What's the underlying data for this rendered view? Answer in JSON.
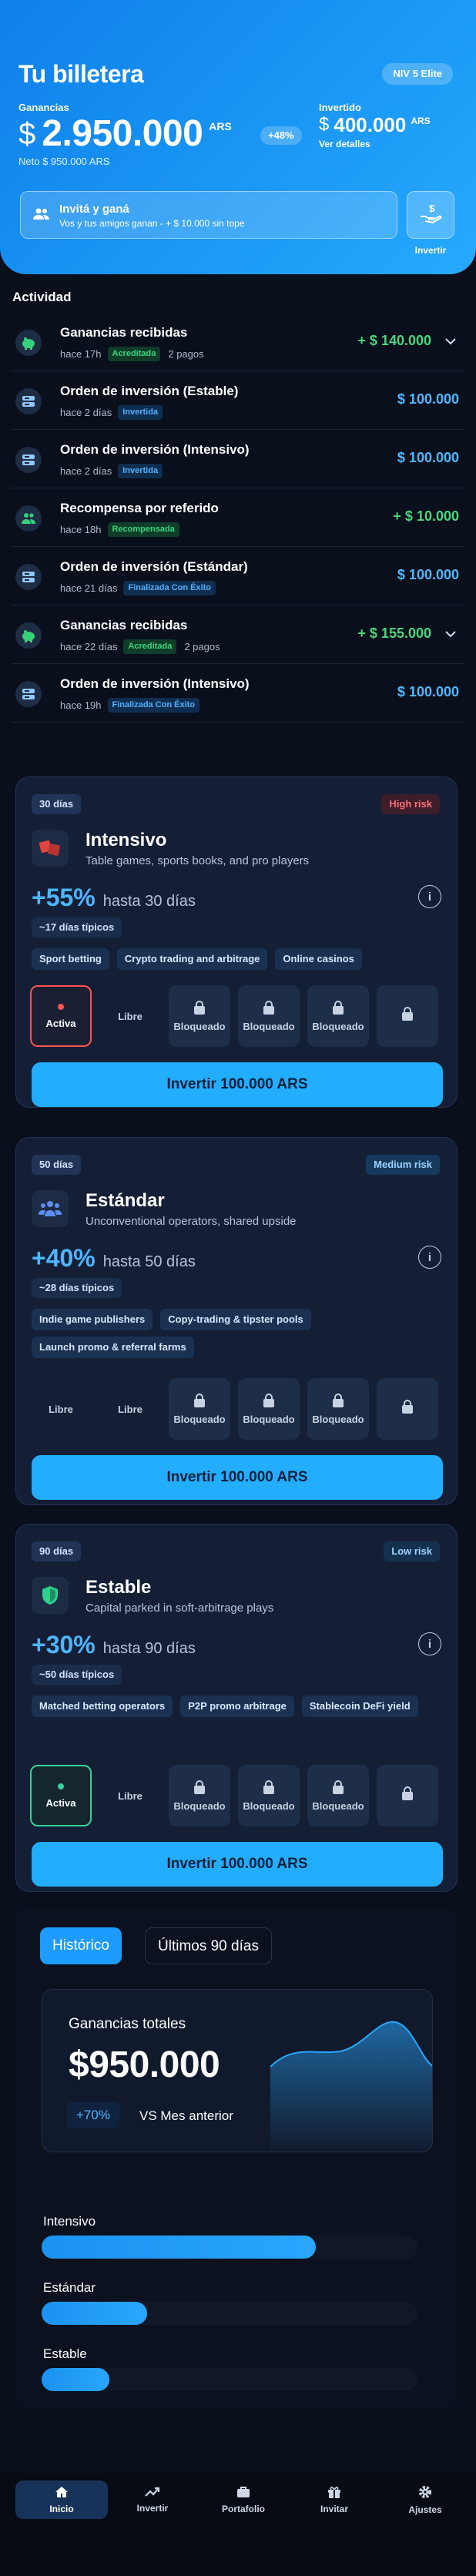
{
  "header": {
    "title": "Tu billetera",
    "level": "NIV 5 Elite",
    "balance_label": "Ganancias",
    "currency_symbol": "$",
    "balance": "2.950.000",
    "balance_unit": "ARS",
    "balance_change": "+48%",
    "net": "Neto $ 950.000 ARS",
    "invested_label": "Invertido",
    "invested": "400.000",
    "invested_unit": "ARS",
    "details": "Ver detalles",
    "invite_title": "Invitá y ganá",
    "invite_sub": "Vos y tus amigos ganan - + $ 10.000 sin tope",
    "invest_button": "Invertir"
  },
  "activity": {
    "title": "Actividad",
    "rows": [
      {
        "title": "Ganancias recibidas",
        "time": "hace 17h",
        "badge": "Acreditada",
        "badge_type": "green",
        "payments": "2 pagos",
        "amount": "+ $ 140.000",
        "positive": true,
        "expand": true,
        "icon": "piggy-bank-icon"
      },
      {
        "title": "Orden de inversión (Estable)",
        "time": "hace 2 días",
        "badge": "Invertida",
        "badge_type": "blue",
        "payments": "",
        "amount": "$ 100.000",
        "positive": false,
        "expand": false,
        "icon": "order-icon"
      },
      {
        "title": "Orden de inversión (Intensivo)",
        "time": "hace 2 días",
        "badge": "Invertida",
        "badge_type": "blue",
        "payments": "",
        "amount": "$ 100.000",
        "positive": false,
        "expand": false,
        "icon": "order-icon"
      },
      {
        "title": "Recompensa por referido",
        "time": "hace 18h",
        "badge": "Recompensada",
        "badge_type": "green",
        "payments": "",
        "amount": "+ $ 10.000",
        "positive": true,
        "expand": false,
        "icon": "users-icon"
      },
      {
        "title": "Orden de inversión (Estándar)",
        "time": "hace 21 días",
        "badge": "Finalizada Con Éxito",
        "badge_type": "blue",
        "payments": "",
        "amount": "$ 100.000",
        "positive": false,
        "expand": false,
        "icon": "order-icon"
      },
      {
        "title": "Ganancias recibidas",
        "time": "hace 22 días",
        "badge": "Acreditada",
        "badge_type": "green",
        "payments": "2 pagos",
        "amount": "+ $ 155.000",
        "positive": true,
        "expand": true,
        "icon": "piggy-bank-icon"
      },
      {
        "title": "Orden de inversión (Intensivo)",
        "time": "hace 19h",
        "badge": "Finalizada Con Éxito",
        "badge_type": "blue",
        "payments": "",
        "amount": "$ 100.000",
        "positive": false,
        "expand": false,
        "icon": "order-icon"
      }
    ]
  },
  "plans": [
    {
      "days": "30 días",
      "risk": "High risk",
      "risk_type": "high",
      "name": "Intensivo",
      "desc": "Table games, sports books, and pro players",
      "yield": "+55%",
      "horizon": "hasta 30 días",
      "typical": "~17 días típicos",
      "tags": [
        "Sport betting",
        "Crypto trading and arbitrage",
        "Online casinos"
      ],
      "slots": [
        {
          "label": "Activa",
          "state": "active-red"
        },
        {
          "label": "Libre",
          "state": "free"
        },
        {
          "label": "Bloqueado",
          "state": "locked"
        },
        {
          "label": "Bloqueado",
          "state": "locked"
        },
        {
          "label": "Bloqueado",
          "state": "locked"
        },
        {
          "label": "",
          "state": "locked"
        }
      ],
      "cta": "Invertir 100.000 ARS",
      "icon": "dice-icon",
      "accent": "#e0443f"
    },
    {
      "days": "50 días",
      "risk": "Medium risk",
      "risk_type": "med",
      "name": "Estándar",
      "desc": "Unconventional operators, shared upside",
      "yield": "+40%",
      "horizon": "hasta 50 días",
      "typical": "~28 días típicos",
      "tags": [
        "Indie game publishers",
        "Copy-trading & tipster pools",
        "Launch promo & referral farms"
      ],
      "slots": [
        {
          "label": "Libre",
          "state": "free"
        },
        {
          "label": "Libre",
          "state": "free"
        },
        {
          "label": "Bloqueado",
          "state": "locked"
        },
        {
          "label": "Bloqueado",
          "state": "locked"
        },
        {
          "label": "Bloqueado",
          "state": "locked"
        },
        {
          "label": "",
          "state": "locked"
        }
      ],
      "cta": "Invertir 100.000 ARS",
      "icon": "group-icon",
      "accent": "#5b8ef0"
    },
    {
      "days": "90 días",
      "risk": "Low risk",
      "risk_type": "low",
      "name": "Estable",
      "desc": "Capital parked in soft-arbitrage plays",
      "yield": "+30%",
      "horizon": "hasta 90 días",
      "typical": "~50 días típicos",
      "tags": [
        "Matched betting operators",
        "P2P promo arbitrage",
        "Stablecoin DeFi yield"
      ],
      "slots": [
        {
          "label": "Activa",
          "state": "active-green"
        },
        {
          "label": "Libre",
          "state": "free"
        },
        {
          "label": "Bloqueado",
          "state": "locked"
        },
        {
          "label": "Bloqueado",
          "state": "locked"
        },
        {
          "label": "Bloqueado",
          "state": "locked"
        },
        {
          "label": "",
          "state": "locked"
        }
      ],
      "cta": "Invertir 100.000 ARS",
      "icon": "shield-icon",
      "accent": "#2fcf8e"
    }
  ],
  "summary": {
    "tab_history": "Histórico",
    "tab_90": "Últimos 90 días",
    "total_label": "Ganancias totales",
    "total": "$950.000",
    "change": "+70%",
    "versus": "VS Mes anterior",
    "bars": [
      {
        "label": "Intensivo",
        "fraction": 0.73
      },
      {
        "label": "Estándar",
        "fraction": 0.28
      },
      {
        "label": "Estable",
        "fraction": 0.18
      }
    ]
  },
  "nav": [
    {
      "label": "Inicio",
      "icon": "home-icon",
      "active": true
    },
    {
      "label": "Invertir",
      "icon": "trend-icon",
      "active": false
    },
    {
      "label": "Portafolio",
      "icon": "briefcase-icon",
      "active": false
    },
    {
      "label": "Invitar",
      "icon": "gift-icon",
      "active": false
    },
    {
      "label": "Ajustes",
      "icon": "gear-icon",
      "active": false
    }
  ],
  "colors": {
    "accent": "#22adff",
    "positive": "#4cd67d",
    "header_from": "#0f7fe9",
    "header_to": "#27a9ff"
  }
}
